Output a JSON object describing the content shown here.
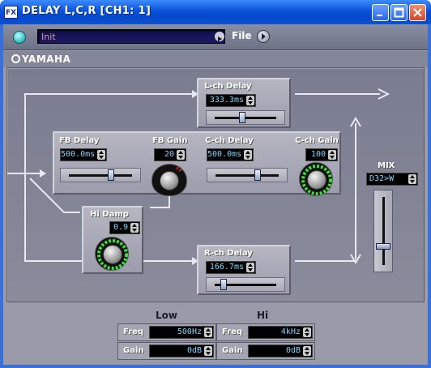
{
  "window": {
    "title": "DELAY L,C,R [CH1: 1]",
    "app_icon": "FX"
  },
  "library": {
    "preset": "Init",
    "file_label": "File"
  },
  "brand": "YAMAHA",
  "lch_delay": {
    "label": "L-ch Delay",
    "value": "333.3ms",
    "slider": 0.45
  },
  "fb_delay": {
    "label": "FB Delay",
    "value": "500.0ms",
    "slider": 0.67
  },
  "fb_gain": {
    "label": "FB Gain",
    "value": "20"
  },
  "cch_delay": {
    "label": "C-ch Delay",
    "value": "500.0ms",
    "slider": 0.67
  },
  "cch_gain": {
    "label": "C-ch Gain",
    "value": "100"
  },
  "hi_damp": {
    "label": "Hi Damp",
    "value": "0.9"
  },
  "rch_delay": {
    "label": "R-ch Delay",
    "value": "166.7ms",
    "slider": 0.12
  },
  "mix": {
    "label": "MIX",
    "value": "D32>W",
    "slider": 0.74
  },
  "eq": {
    "low": {
      "heading": "Low",
      "freq_label": "Freq",
      "freq": "500Hz",
      "gain_label": "Gain",
      "gain": "0dB"
    },
    "hi": {
      "heading": "Hi",
      "freq_label": "Freq",
      "freq": "4kHz",
      "gain_label": "Gain",
      "gain": "0dB"
    }
  },
  "colors": {
    "title_blue": "#0548cc",
    "lcd_text": "#7fd7ff",
    "ring_green": "#3ddc3d",
    "ring_red": "#e02020"
  }
}
